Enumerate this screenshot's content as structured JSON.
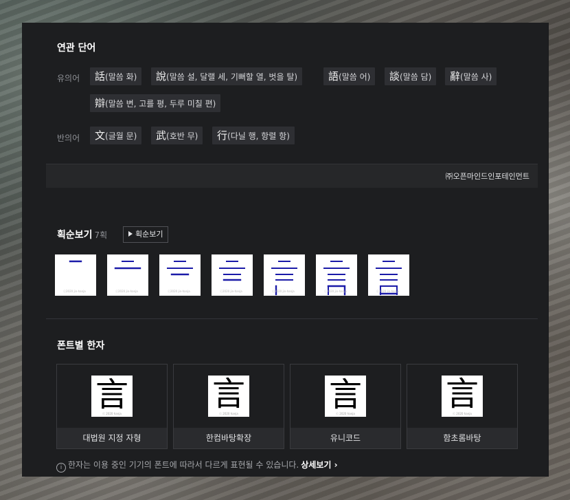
{
  "related": {
    "title": "연관 단어",
    "synonym_label": "유의어",
    "antonym_label": "반의어",
    "synonyms": [
      {
        "hanja": "話",
        "meaning": "(말씀 화)"
      },
      {
        "hanja": "說",
        "meaning": "(말씀 설, 달랠 세, 기뻐할 열, 벗을 탈)"
      },
      {
        "hanja": "語",
        "meaning": "(말씀 어)"
      },
      {
        "hanja": "談",
        "meaning": "(말씀 담)"
      },
      {
        "hanja": "辭",
        "meaning": "(말씀 사)"
      },
      {
        "hanja": "辯",
        "meaning": "(말씀 변, 고를 평, 두루 미칠 편)"
      }
    ],
    "antonyms": [
      {
        "hanja": "文",
        "meaning": "(글월 문)"
      },
      {
        "hanja": "武",
        "meaning": "(호반 무)"
      },
      {
        "hanja": "行",
        "meaning": "(다닐 행, 항렬 항)"
      }
    ],
    "copyright": "㈜오픈마인드인포테인먼트"
  },
  "stroke_order": {
    "title": "획순보기",
    "count": "7획",
    "button_label": "획순보기",
    "watermark": "ⓒ2020 jin-hanja",
    "steps": 7
  },
  "fonts": {
    "title": "폰트별 한자",
    "glyph": "言",
    "watermark": "ⓒ 2020 hanja",
    "cards": [
      {
        "name": "대법원 지정 자형"
      },
      {
        "name": "한컴바탕확장"
      },
      {
        "name": "유니코드"
      },
      {
        "name": "함초롬바탕"
      }
    ],
    "notice": "한자는 이용 중인 기기의 폰트에 따라서 다르게 표현될 수 있습니다.",
    "more_label": "상세보기",
    "info_icon": "i"
  },
  "colors": {
    "panel_bg": "#1d1e20",
    "chip_bg": "#2e2f33",
    "stroke_highlight": "#1a1aa8",
    "stroke_done": "#000000"
  }
}
